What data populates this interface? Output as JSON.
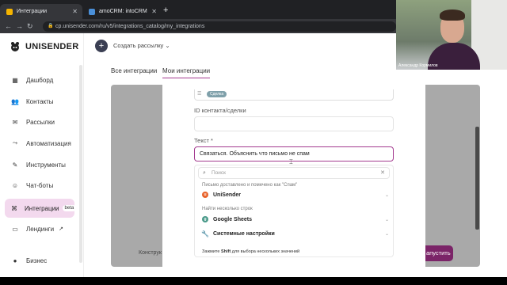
{
  "browser": {
    "tabs": [
      {
        "label": "Интеграции",
        "active": true
      },
      {
        "label": "amoCRM: intoCRM",
        "active": false
      }
    ],
    "new_tab": "+",
    "url": "cp.unisender.com/ru/v5/integrations_catalog/my_integrations"
  },
  "sidebar": {
    "brand": "UNISENDER",
    "items": [
      {
        "label": "Дашборд",
        "icon": "dashboard-icon"
      },
      {
        "label": "Контакты",
        "icon": "contacts-icon"
      },
      {
        "label": "Рассылки",
        "icon": "mail-icon"
      },
      {
        "label": "Автоматизация",
        "icon": "automation-icon"
      },
      {
        "label": "Инструменты",
        "icon": "tools-icon"
      },
      {
        "label": "Чат-боты",
        "icon": "bot-icon"
      },
      {
        "label": "Интеграции",
        "icon": "integrations-icon",
        "badge": "beta",
        "active": true
      },
      {
        "label": "Лендинги",
        "icon": "landing-icon"
      },
      {
        "label": "Бизнес",
        "icon": "business-icon"
      }
    ]
  },
  "topbar": {
    "create_label": "Создать рассылку"
  },
  "main_tabs": [
    {
      "label": "Все интеграции",
      "active": false
    },
    {
      "label": "Мои интеграции",
      "active": true
    }
  ],
  "background": {
    "left_text": "Конструк",
    "run_button": "апустить"
  },
  "form": {
    "badge": "Сделка",
    "id_label": "ID контакта/сделки",
    "id_value": "",
    "text_label": "Текст *",
    "text_value": "Связаться. Объяснить что письмо не спам"
  },
  "dropdown": {
    "search_placeholder": "Поиск",
    "groups": [
      {
        "title": "Письмо доставлено и помечено как \"Спам\"",
        "options": [
          {
            "label": "UniSender",
            "color": "#e8632b"
          }
        ]
      },
      {
        "title": "Найти несколько строк",
        "options": [
          {
            "label": "Google Sheets",
            "color": "#4a9a8a"
          },
          {
            "label": "Системные настройки",
            "color": "#888888"
          }
        ]
      }
    ],
    "hint_prefix": "Зажмите",
    "hint_key": "Shift",
    "hint_suffix": "для выбора нескольких значений"
  },
  "video": {
    "name": "Александр Кормилов"
  },
  "colors": {
    "accent": "#a33a8f",
    "active_bg": "#f3d9ee",
    "run_button": "#7b2468"
  }
}
